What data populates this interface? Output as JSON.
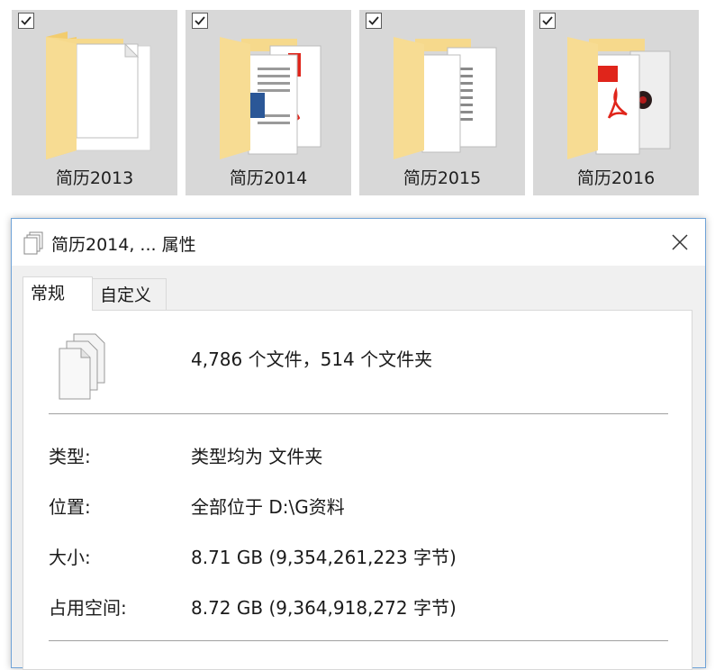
{
  "folders": [
    {
      "label": "简历2013",
      "checked": true,
      "preview": "blank"
    },
    {
      "label": "简历2014",
      "checked": true,
      "preview": "word-pdf"
    },
    {
      "label": "简历2015",
      "checked": true,
      "preview": "documents"
    },
    {
      "label": "简历2016",
      "checked": true,
      "preview": "pdf"
    }
  ],
  "dialog": {
    "title": "简历2014, ... 属性",
    "tabs": [
      {
        "label": "常规",
        "active": true
      },
      {
        "label": "自定义",
        "active": false
      }
    ],
    "summary": "4,786 个文件，514 个文件夹",
    "rows": [
      {
        "label": "类型:",
        "value": "类型均为 文件夹"
      },
      {
        "label": "位置:",
        "value": "全部位于 D:\\G资料"
      },
      {
        "label": "大小:",
        "value": "8.71 GB (9,354,261,223 字节)"
      },
      {
        "label": "占用空间:",
        "value": "8.72 GB (9,364,918,272 字节)"
      }
    ]
  },
  "colors": {
    "tile_selected": "#d8d8d8",
    "folder_yellow": "#f6d98c",
    "dialog_border": "#6fa3d8",
    "pdf_red": "#e0251b",
    "word_blue": "#2b5797"
  }
}
